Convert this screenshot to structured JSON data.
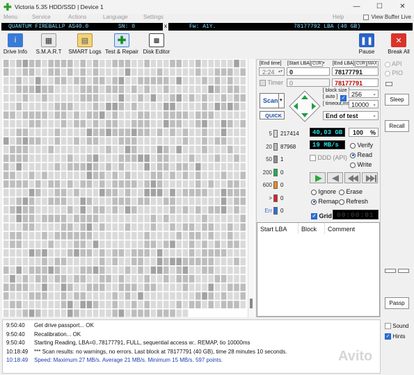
{
  "window": {
    "title": "Victoria 5.35 HDD/SSD | Device 1",
    "min": "—",
    "max": "☐",
    "close": "✕"
  },
  "menu": {
    "items": [
      "Menu",
      "Service",
      "Actions",
      "Language",
      "Settings"
    ],
    "help": "Help",
    "view_buffer_live": "View Buffer Live"
  },
  "drive": {
    "model": "QUANTUM FIREBALLP AS40.0",
    "sn": "SN: 0",
    "sep": "x",
    "fw": "Fw: A1Y.",
    "lba": "78177792 LBA (40 GB)"
  },
  "toolbar": {
    "drive_info": "Drive Info",
    "smart": "S.M.A.R.T",
    "smart_logs": "SMART Logs",
    "test_repair": "Test & Repair",
    "disk_editor": "Disk Editor",
    "pause": "Pause",
    "break_all": "Break All"
  },
  "test": {
    "end_time_label": "End time",
    "end_time": "2:24",
    "start_lba_label": "Start LBA",
    "cur": "CUR",
    "start_lba": "0",
    "end_lba_label": "End LBA",
    "max": "MAX",
    "end_lba": "78177791",
    "end_lba2": "78177791",
    "timer_label": "Timer",
    "timer_value": "0",
    "scan_button": "Scan",
    "quick_button": "QUICK",
    "block_size_label": "block size",
    "auto_label": "auto",
    "block_size": "256",
    "timeout_label": "timeout,ms",
    "timeout": "10000",
    "end_mode": "End of test"
  },
  "counters": [
    {
      "label": "5",
      "value": "217414"
    },
    {
      "label": "20",
      "value": "87968"
    },
    {
      "label": "50",
      "value": "1"
    },
    {
      "label": "200",
      "value": "0"
    },
    {
      "label": "600",
      "value": "0"
    },
    {
      "label": ">",
      "value": "0"
    },
    {
      "label": "Err",
      "value": "0"
    }
  ],
  "status": {
    "size_read": "40,03 GB",
    "percent": "100",
    "percent_unit": "%",
    "speed": "19 MB/s",
    "ddd": "DDD (API)"
  },
  "verify_mode": {
    "verify": "Verify",
    "read": "Read",
    "write": "Write",
    "selected": "Read"
  },
  "repair_mode": {
    "ignore": "Ignore",
    "erase": "Erase",
    "remap": "Remap",
    "refresh": "Refresh",
    "selected": "Remap"
  },
  "grid_toggle": {
    "label": "Grid",
    "timer_display": "00:00:01"
  },
  "defects_table": {
    "columns": [
      "Start LBA",
      "Block",
      "Comment"
    ]
  },
  "side": {
    "api": "API",
    "pio": "PIO",
    "sleep": "Sleep",
    "recall": "Recall",
    "passp": "Passp"
  },
  "log": [
    {
      "time": "9:50:40",
      "text": "Get drive passport... OK",
      "style": "normal"
    },
    {
      "time": "9:50:40",
      "text": "Recalibration... OK",
      "style": "normal"
    },
    {
      "time": "9:50:40",
      "text": "Starting Reading, LBA=0..78177791, FULL, sequential access w:. REMAP, tio 10000ms",
      "style": "normal"
    },
    {
      "time": "10:18:49",
      "text": "*** Scan results: no warnings, no errors. Last block at 78177791 (40 GB), time 28 minutes 10 seconds.",
      "style": "normal"
    },
    {
      "time": "10:18:49",
      "text": "Speed: Maximum 27 MB/s. Average 21 MB/s. Minimum 15 MB/s. 597 points.",
      "style": "blue"
    }
  ],
  "log_options": {
    "sound": "Sound",
    "hints": "Hints"
  },
  "watermark": "Avito",
  "colors": {
    "led_text": "#26e0e0",
    "accent": "#2f6fd6",
    "break_red": "#d9342b",
    "pause_blue": "#2b63c6"
  }
}
